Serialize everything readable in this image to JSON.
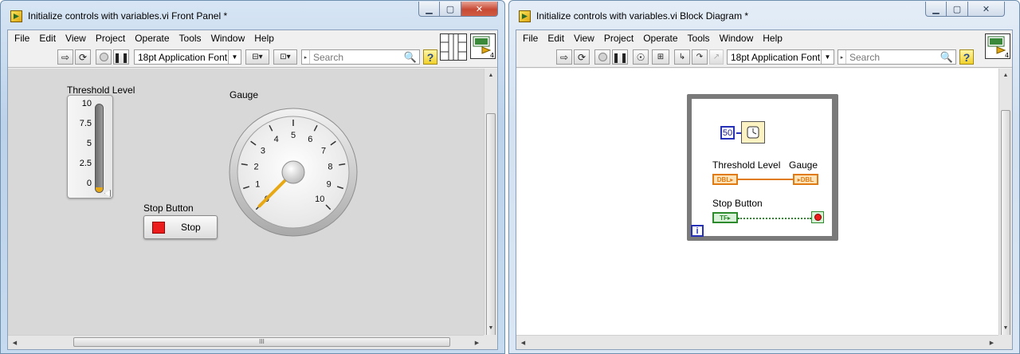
{
  "front_panel": {
    "title": "Initialize controls with variables.vi Front Panel *",
    "menu": [
      "File",
      "Edit",
      "View",
      "Project",
      "Operate",
      "Tools",
      "Window",
      "Help"
    ],
    "font": "18pt Application Font",
    "search_placeholder": "Search",
    "threshold": {
      "label": "Threshold Level",
      "ticks": [
        "10",
        "7.5",
        "5",
        "2.5",
        "0"
      ],
      "value": 0,
      "max": 10
    },
    "gauge": {
      "label": "Gauge",
      "ticks": [
        "0",
        "1",
        "2",
        "3",
        "4",
        "5",
        "6",
        "7",
        "8",
        "9",
        "10"
      ],
      "value": 0
    },
    "stop_button": {
      "label": "Stop Button",
      "text": "Stop"
    },
    "hscroll_grip": "III"
  },
  "block_diagram": {
    "title": "Initialize controls with variables.vi Block Diagram *",
    "menu": [
      "File",
      "Edit",
      "View",
      "Project",
      "Operate",
      "Tools",
      "Window",
      "Help"
    ],
    "font": "18pt Application Font",
    "search_placeholder": "Search",
    "wait_constant": "50",
    "threshold_label": "Threshold Level",
    "gauge_label": "Gauge",
    "stop_label": "Stop Button",
    "dbl_tag": "DBL",
    "tf_tag": "TF",
    "iteration": "i"
  },
  "colors": {
    "numeric_wire": "#e07b14",
    "boolean_wire": "#2d8b2d",
    "constant_blue": "#2631b8",
    "stop_red": "#ec1c1c",
    "gauge_needle": "#e8a814"
  },
  "icons": {
    "run": "run-arrow-icon",
    "run_continuous": "run-continuously-icon",
    "abort": "abort-icon",
    "pause": "pause-icon",
    "highlight": "highlight-execution-icon",
    "help": "context-help-icon"
  }
}
